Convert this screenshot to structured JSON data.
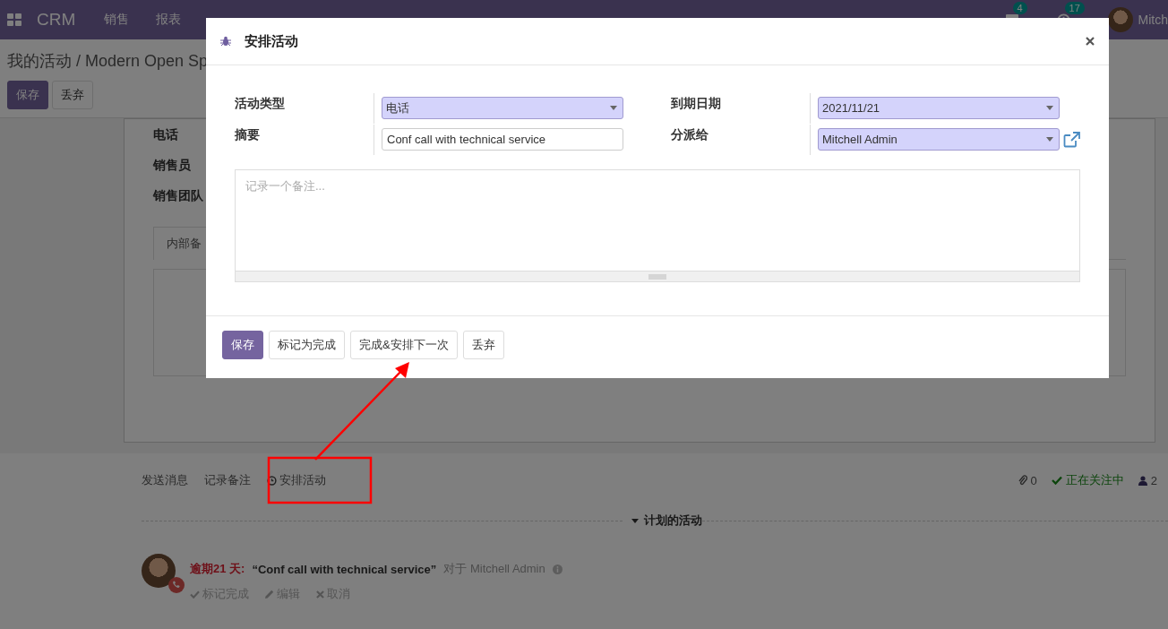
{
  "navbar": {
    "app": "CRM",
    "menus": [
      "销售",
      "报表"
    ],
    "badges": [
      {
        "count": "4",
        "kind": "chat"
      },
      {
        "count": "17",
        "kind": "clock"
      }
    ],
    "user": "Mitch"
  },
  "breadcrumb": "我的活动 / Modern Open Sp",
  "page_buttons": [
    {
      "label": "保存",
      "primary": true
    },
    {
      "label": "丢弃",
      "primary": false
    }
  ],
  "form_labels": [
    "电话",
    "销售员",
    "销售团队"
  ],
  "tab": "内部备",
  "chatter": {
    "actions": [
      {
        "label": "发送消息",
        "icon": false
      },
      {
        "label": "记录备注",
        "icon": false
      },
      {
        "label": "安排活动",
        "icon": true
      }
    ],
    "attachments": "0",
    "following": "正在关注中",
    "followers": "2",
    "section": "计划的活动",
    "activity": {
      "due": "逾期21 天:",
      "summary": "“Conf call with technical service”",
      "for": "对于 Mitchell Admin",
      "actions": [
        {
          "label": "标记完成",
          "kind": "check"
        },
        {
          "label": "编辑",
          "kind": "pencil"
        },
        {
          "label": "取消",
          "kind": "times"
        }
      ]
    }
  },
  "dialog": {
    "title": "安排活动",
    "fields": [
      {
        "label": "活动类型",
        "value": "电话",
        "kind": "select"
      },
      {
        "label": "到期日期",
        "value": "2021/11/21",
        "kind": "select"
      },
      {
        "label": "摘要",
        "value": "Conf call with technical service",
        "kind": "text"
      },
      {
        "label": "分派给",
        "value": "Mitchell Admin",
        "kind": "select",
        "link": true
      }
    ],
    "note_placeholder": "记录一个备注...",
    "buttons": [
      {
        "label": "保存",
        "primary": true
      },
      {
        "label": "标记为完成",
        "primary": false
      },
      {
        "label": "完成&安排下一次",
        "primary": false
      },
      {
        "label": "丢弃",
        "primary": false
      }
    ]
  }
}
